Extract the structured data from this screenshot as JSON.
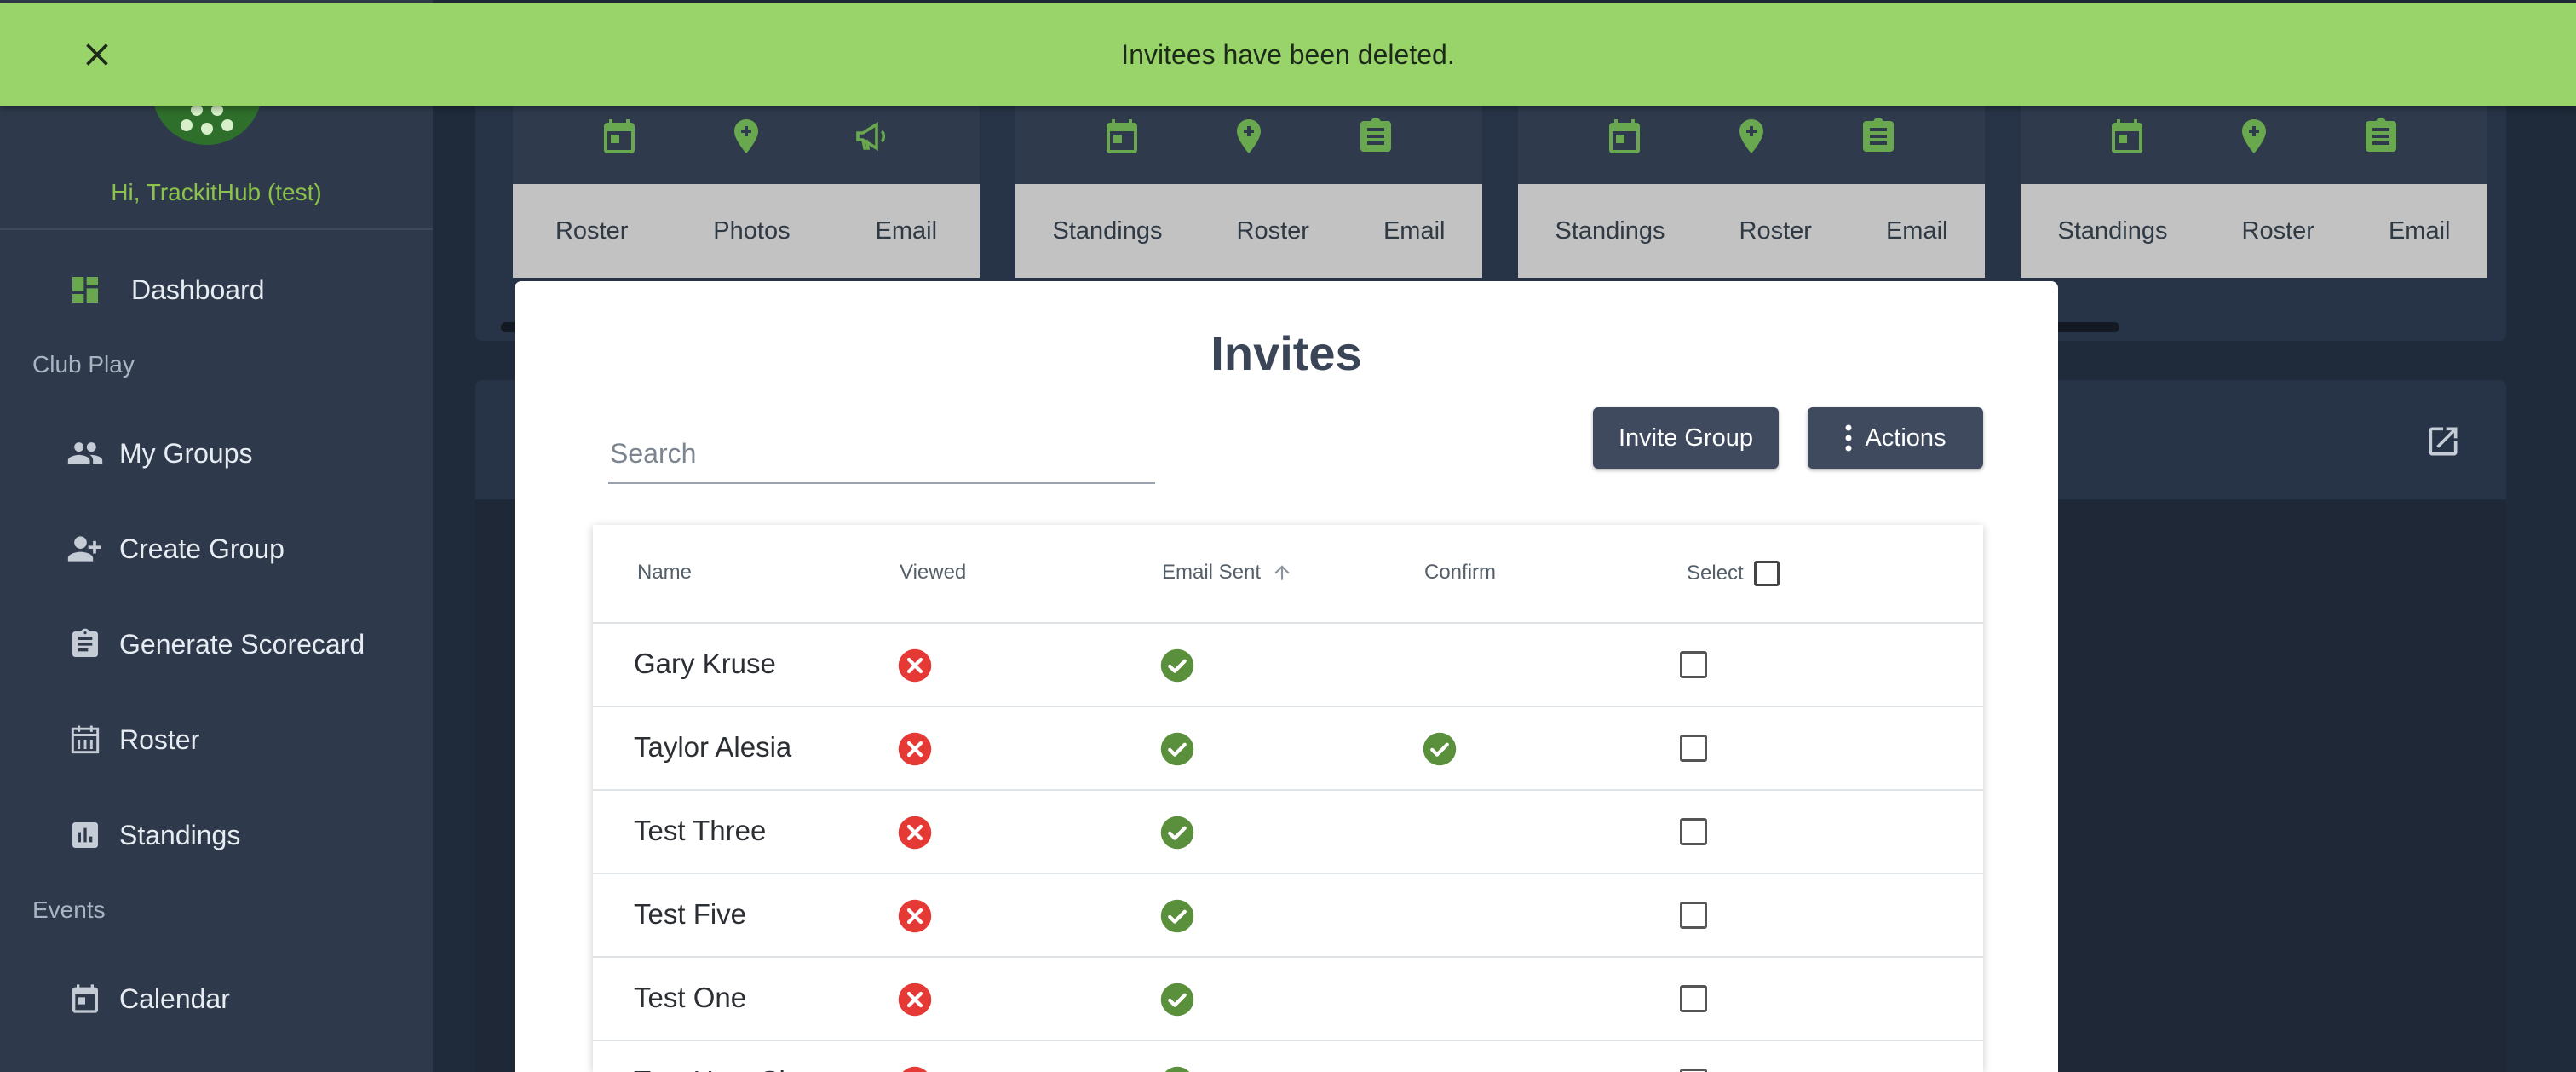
{
  "notification": {
    "message": "Invitees have been deleted."
  },
  "sidebar": {
    "greeting": "Hi, TrackitHub (test)",
    "dashboard": "Dashboard",
    "section_club": "Club Play",
    "club_items": [
      "My Groups",
      "Create Group",
      "Generate Scorecard",
      "Roster",
      "Standings"
    ],
    "section_events": "Events",
    "events_items": [
      "Calendar"
    ]
  },
  "cards": [
    {
      "icons": [
        "calendar-icon",
        "location-pin-icon",
        "megaphone-icon"
      ],
      "links": [
        "Roster",
        "Photos",
        "Email"
      ]
    },
    {
      "icons": [
        "calendar-icon",
        "location-pin-icon",
        "clipboard-icon"
      ],
      "links": [
        "Standings",
        "Roster",
        "Email"
      ]
    },
    {
      "icons": [
        "calendar-icon",
        "location-pin-icon",
        "clipboard-icon"
      ],
      "links": [
        "Standings",
        "Roster",
        "Email"
      ]
    },
    {
      "icons": [
        "calendar-icon",
        "location-pin-icon",
        "clipboard-icon"
      ],
      "links": [
        "Standings",
        "Roster",
        "Email"
      ]
    }
  ],
  "modal": {
    "title": "Invites",
    "search_placeholder": "Search",
    "invite_group_label": "Invite Group",
    "actions_label": "Actions",
    "columns": {
      "name": "Name",
      "viewed": "Viewed",
      "email_sent": "Email Sent",
      "confirm": "Confirm",
      "select": "Select"
    },
    "rows": [
      {
        "name": "Gary Kruse",
        "viewed": false,
        "email_sent": true,
        "confirm": null,
        "selected": false
      },
      {
        "name": "Taylor Alesia",
        "viewed": false,
        "email_sent": true,
        "confirm": true,
        "selected": false
      },
      {
        "name": "Test Three",
        "viewed": false,
        "email_sent": true,
        "confirm": null,
        "selected": false
      },
      {
        "name": "Test Five",
        "viewed": false,
        "email_sent": true,
        "confirm": null,
        "selected": false
      },
      {
        "name": "Test One",
        "viewed": false,
        "email_sent": true,
        "confirm": null,
        "selected": false
      },
      {
        "name": "Test User Six",
        "viewed": false,
        "email_sent": true,
        "confirm": null,
        "selected": false
      }
    ]
  },
  "colors": {
    "accent": "#8bc34a",
    "notify_bg": "#98d46a",
    "error": "#e53935",
    "success": "#5a8f3c",
    "nav_bg": "#2e3a4b"
  }
}
